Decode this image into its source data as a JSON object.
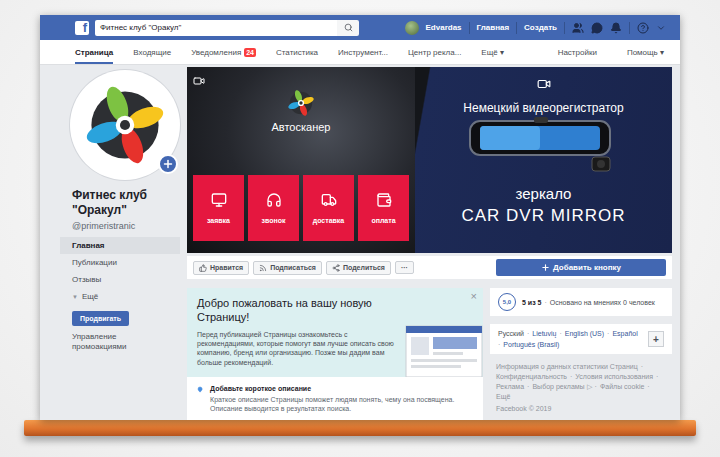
{
  "topbar": {
    "logo": "f",
    "search": "Фитнес клуб \"Оракул\"",
    "user": "Edvardas",
    "links": [
      "Главная",
      "Создать"
    ]
  },
  "subnav": {
    "tabs": [
      {
        "label": "Страница",
        "selected": true
      },
      {
        "label": "Входящие",
        "selected": false
      },
      {
        "label": "Уведомления",
        "selected": false,
        "badge": "24"
      },
      {
        "label": "Статистика",
        "selected": false
      },
      {
        "label": "Инструмент...",
        "selected": false
      },
      {
        "label": "Центр рекла...",
        "selected": false
      },
      {
        "label": "Ещё ▾",
        "selected": false
      }
    ],
    "right": [
      "Настройки",
      "Помощь ▾"
    ]
  },
  "page": {
    "name": "Фитнес клуб \"Оракул\"",
    "handle": "@primeristranic"
  },
  "sidebar": {
    "items": [
      {
        "label": "Главная",
        "selected": true
      },
      {
        "label": "Публикации",
        "selected": false
      },
      {
        "label": "Отзывы",
        "selected": false
      },
      {
        "label": "Ещё",
        "selected": false,
        "icon": "▼"
      }
    ],
    "promote": "Продвигать",
    "manage": "Управление промоакциями"
  },
  "cover": {
    "brand": "Автосканер",
    "tiles": [
      "заявка",
      "звонок",
      "доставка",
      "оплата"
    ],
    "headline": "Немецкий видеорегистратор",
    "product": "зеркало",
    "model": "CAR DVR MIRROR"
  },
  "actions": {
    "buttons": [
      "Нравится",
      "Подписаться",
      "Поделиться"
    ],
    "more": "···",
    "cta": "Добавить кнопку"
  },
  "welcome": {
    "title": "Добро пожаловать на вашу новую Страницу!",
    "text": "Перед публикацией Страницы ознакомьтесь с рекомендациями, которые помогут вам лучше описать свою компанию, бренд или организацию. Позже мы дадим вам больше рекомендаций.",
    "close": "×",
    "tip": {
      "title": "Добавьте короткое описание",
      "text": "Краткое описание Страницы поможет людям понять, чему она посвящена. Описание выводится в результатах поиска."
    }
  },
  "rating": {
    "score": "5,0",
    "summary": "5 из 5",
    "separator": "·",
    "basis": "Основано на мнениях 0 человек"
  },
  "languages": {
    "items": [
      {
        "label": "Русский",
        "selected": true
      },
      {
        "label": "Lietuvių",
        "selected": false
      },
      {
        "label": "English (US)",
        "selected": false
      },
      {
        "label": "Español",
        "selected": false
      },
      {
        "label": "Português (Brasil)",
        "selected": false
      }
    ],
    "separator": "·",
    "add": "+"
  },
  "footer": {
    "links": [
      "Информация о данных статистики Страниц",
      "Конфиденциальность",
      "Условия использования",
      "Реклама",
      "Выбор рекламы ▷",
      "Файлы cookie",
      "Ещё"
    ],
    "separator": "·",
    "copyright": "Facebook © 2019"
  }
}
